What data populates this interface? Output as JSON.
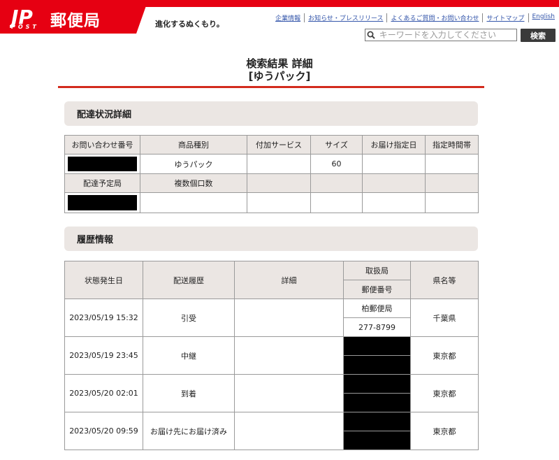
{
  "header": {
    "brand_logo_text": "JP",
    "brand_post": "POST",
    "brand_name": "郵便局",
    "tagline": "進化するぬくもり。",
    "links": [
      "企業情報",
      "お知らせ・プレスリリース",
      "よくあるご質問・お問い合わせ",
      "サイトマップ",
      "English"
    ],
    "search_placeholder": "キーワードを入力してください",
    "search_button": "検索"
  },
  "page": {
    "title": "検索結果 詳細",
    "subtitle": "[ゆうパック]"
  },
  "delivery_status": {
    "heading": "配達状況詳細",
    "headers": [
      "お問い合わせ番号",
      "商品種別",
      "付加サービス",
      "サイズ",
      "お届け指定日",
      "指定時間帯"
    ],
    "row1": {
      "tracking_number": "",
      "product_type": "ゆうパック",
      "additional_service": "",
      "size": "60",
      "delivery_date": "",
      "time_slot": ""
    },
    "sub_headers": [
      "配達予定局",
      "複数個口数"
    ],
    "row2": {
      "scheduled_office": "",
      "package_count": ""
    }
  },
  "history": {
    "heading": "履歴情報",
    "headers": {
      "date": "状態発生日",
      "status": "配送履歴",
      "detail": "詳細",
      "office": "取扱局",
      "postal_code": "郵便番号",
      "prefecture": "県名等"
    },
    "rows": [
      {
        "date": "2023/05/19 15:32",
        "status": "引受",
        "detail": "",
        "office": "柏郵便局",
        "postal_code": "277-8799",
        "prefecture": "千葉県"
      },
      {
        "date": "2023/05/19 23:45",
        "status": "中継",
        "detail": "",
        "office": "",
        "postal_code": "",
        "prefecture": "東京都"
      },
      {
        "date": "2023/05/20 02:01",
        "status": "到着",
        "detail": "",
        "office": "",
        "postal_code": "",
        "prefecture": "東京都"
      },
      {
        "date": "2023/05/20 09:59",
        "status": "お届け先にお届け済み",
        "detail": "",
        "office": "",
        "postal_code": "",
        "prefecture": "東京都"
      }
    ]
  },
  "colors": {
    "brand_red": "#e60012",
    "section_bg": "#ebe6e3",
    "redaction": "#000000"
  }
}
